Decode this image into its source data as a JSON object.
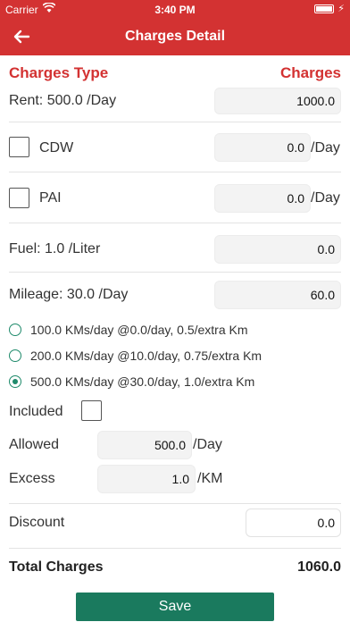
{
  "status_bar": {
    "carrier": "Carrier",
    "time": "3:40 PM"
  },
  "nav": {
    "title": "Charges Detail",
    "back_icon": "arrow-left-icon"
  },
  "header": {
    "left": "Charges Type",
    "right": "Charges"
  },
  "rent": {
    "label": "Rent: 500.0 /Day",
    "value": "1000.0"
  },
  "cdw": {
    "label": "CDW",
    "value": "0.0",
    "unit": "/Day",
    "checked": false
  },
  "pai": {
    "label": "PAI",
    "value": "0.0",
    "unit": "/Day",
    "checked": false
  },
  "fuel": {
    "label": "Fuel: 1.0 /Liter",
    "value": "0.0"
  },
  "mileage": {
    "label": "Mileage: 30.0 /Day",
    "value": "60.0"
  },
  "mileage_options": [
    {
      "label": "100.0 KMs/day @0.0/day, 0.5/extra Km",
      "selected": false
    },
    {
      "label": "200.0 KMs/day @10.0/day, 0.75/extra Km",
      "selected": false
    },
    {
      "label": "500.0 KMs/day @30.0/day, 1.0/extra Km",
      "selected": true
    }
  ],
  "included": {
    "label": "Included",
    "checked": false
  },
  "allowed": {
    "label": "Allowed",
    "value": "500.0",
    "unit": "/Day"
  },
  "excess": {
    "label": "Excess",
    "value": "1.0",
    "unit": "/KM"
  },
  "discount": {
    "label": "Discount",
    "value": "0.0"
  },
  "total": {
    "label": "Total Charges",
    "value": "1060.0"
  },
  "save_label": "Save",
  "colors": {
    "primary": "#d33232",
    "accent": "#1a7a5e"
  }
}
